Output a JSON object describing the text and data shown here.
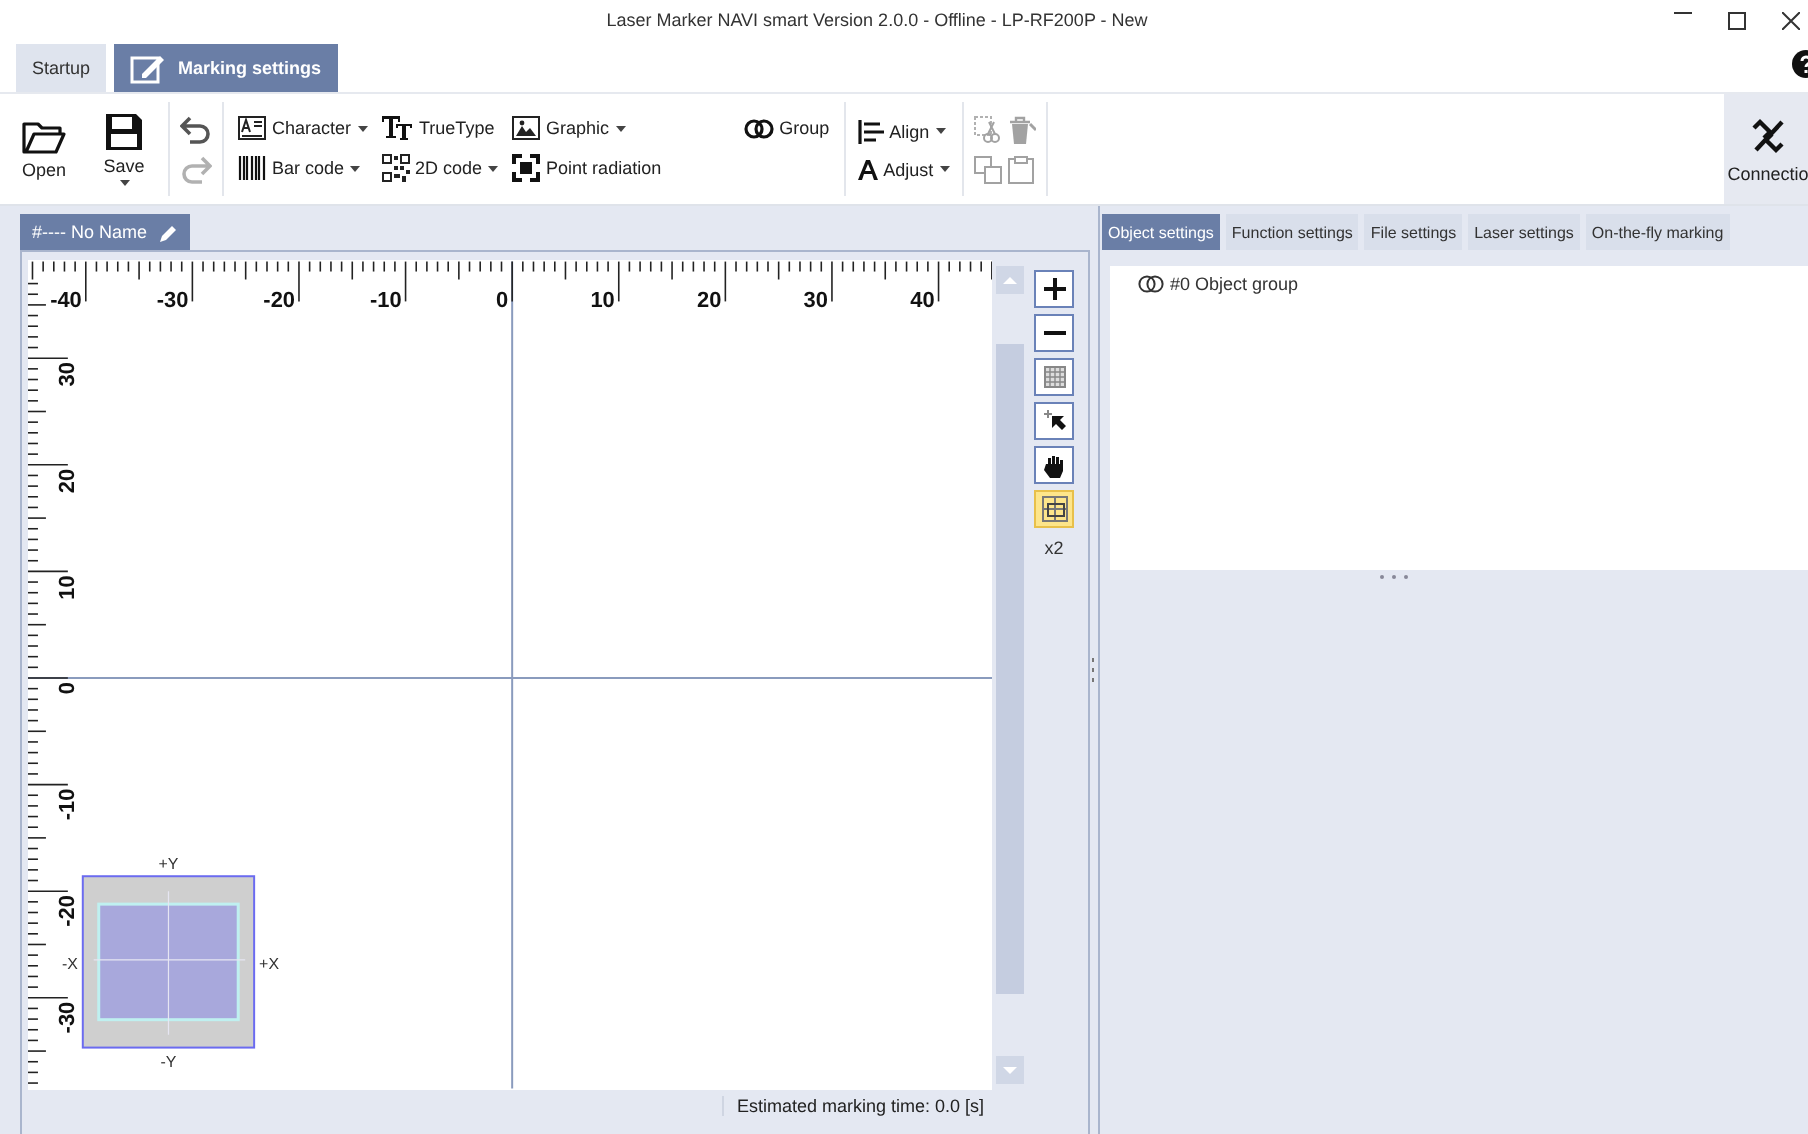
{
  "window": {
    "title": "Laser Marker NAVI smart  Version 2.0.0 - Offline - LP-RF200P - New"
  },
  "ribbon_tabs": [
    {
      "label": "Startup",
      "selected": false
    },
    {
      "label": "Marking settings",
      "selected": true
    }
  ],
  "file_tools": [
    {
      "kind": "open",
      "label": "Open",
      "dropdown": false
    },
    {
      "kind": "save",
      "label": "Save",
      "dropdown": true
    }
  ],
  "history_tools": [
    {
      "kind": "undo",
      "disabled": false
    },
    {
      "kind": "redo",
      "disabled": true
    }
  ],
  "insert_rows": [
    [
      {
        "kind": "character",
        "label": "Character",
        "dropdown": true
      },
      {
        "kind": "truetype",
        "label": "TrueType",
        "dropdown": false
      },
      {
        "kind": "graphic",
        "label": "Graphic",
        "dropdown": true
      },
      {
        "kind": "group",
        "label": "Group",
        "dropdown": false
      }
    ],
    [
      {
        "kind": "barcode",
        "label": "Bar code",
        "dropdown": true
      },
      {
        "kind": "qrcode",
        "label": "2D code",
        "dropdown": true
      },
      {
        "kind": "point",
        "label": "Point radiation",
        "dropdown": false
      }
    ]
  ],
  "arrange_tools": [
    {
      "kind": "align",
      "label": "Align",
      "dropdown": true
    },
    {
      "kind": "adjust",
      "label": "Adjust",
      "dropdown": true
    }
  ],
  "edit_tools": [
    {
      "kind": "cut",
      "disabled": true
    },
    {
      "kind": "delete",
      "disabled": true
    },
    {
      "kind": "copy",
      "disabled": true
    },
    {
      "kind": "paste",
      "disabled": true
    }
  ],
  "connection": {
    "label": "Connectio"
  },
  "document_tab": {
    "label": "#---- No Name",
    "selected": true
  },
  "canvas": {
    "x_labels": [
      "-40",
      "-30",
      "-20",
      "-10",
      "0",
      "10",
      "20",
      "30",
      "40"
    ],
    "y_labels": [
      "30",
      "20",
      "10",
      "0",
      "-10",
      "-20",
      "-30"
    ],
    "preview": {
      "top": "+Y",
      "left": "-X",
      "right": "+X",
      "bottom": "-Y"
    },
    "tools": [
      {
        "kind": "zoom-in",
        "selected": false
      },
      {
        "kind": "zoom-out",
        "selected": false
      },
      {
        "kind": "grid",
        "selected": false
      },
      {
        "kind": "select",
        "selected": false
      },
      {
        "kind": "hand",
        "selected": false
      },
      {
        "kind": "fit",
        "selected": true
      }
    ],
    "zoom": "x2"
  },
  "status_bar": {
    "text": "Estimated marking time: 0.0 [s]"
  },
  "settings_tabs": [
    {
      "label": "Object settings",
      "selected": true
    },
    {
      "label": "Function settings",
      "selected": false
    },
    {
      "label": "File settings",
      "selected": false
    },
    {
      "label": "Laser settings",
      "selected": false
    },
    {
      "label": "On-the-fly marking",
      "selected": false
    }
  ],
  "object_tree": [
    {
      "label": "#0 Object group",
      "kind": "group"
    }
  ]
}
